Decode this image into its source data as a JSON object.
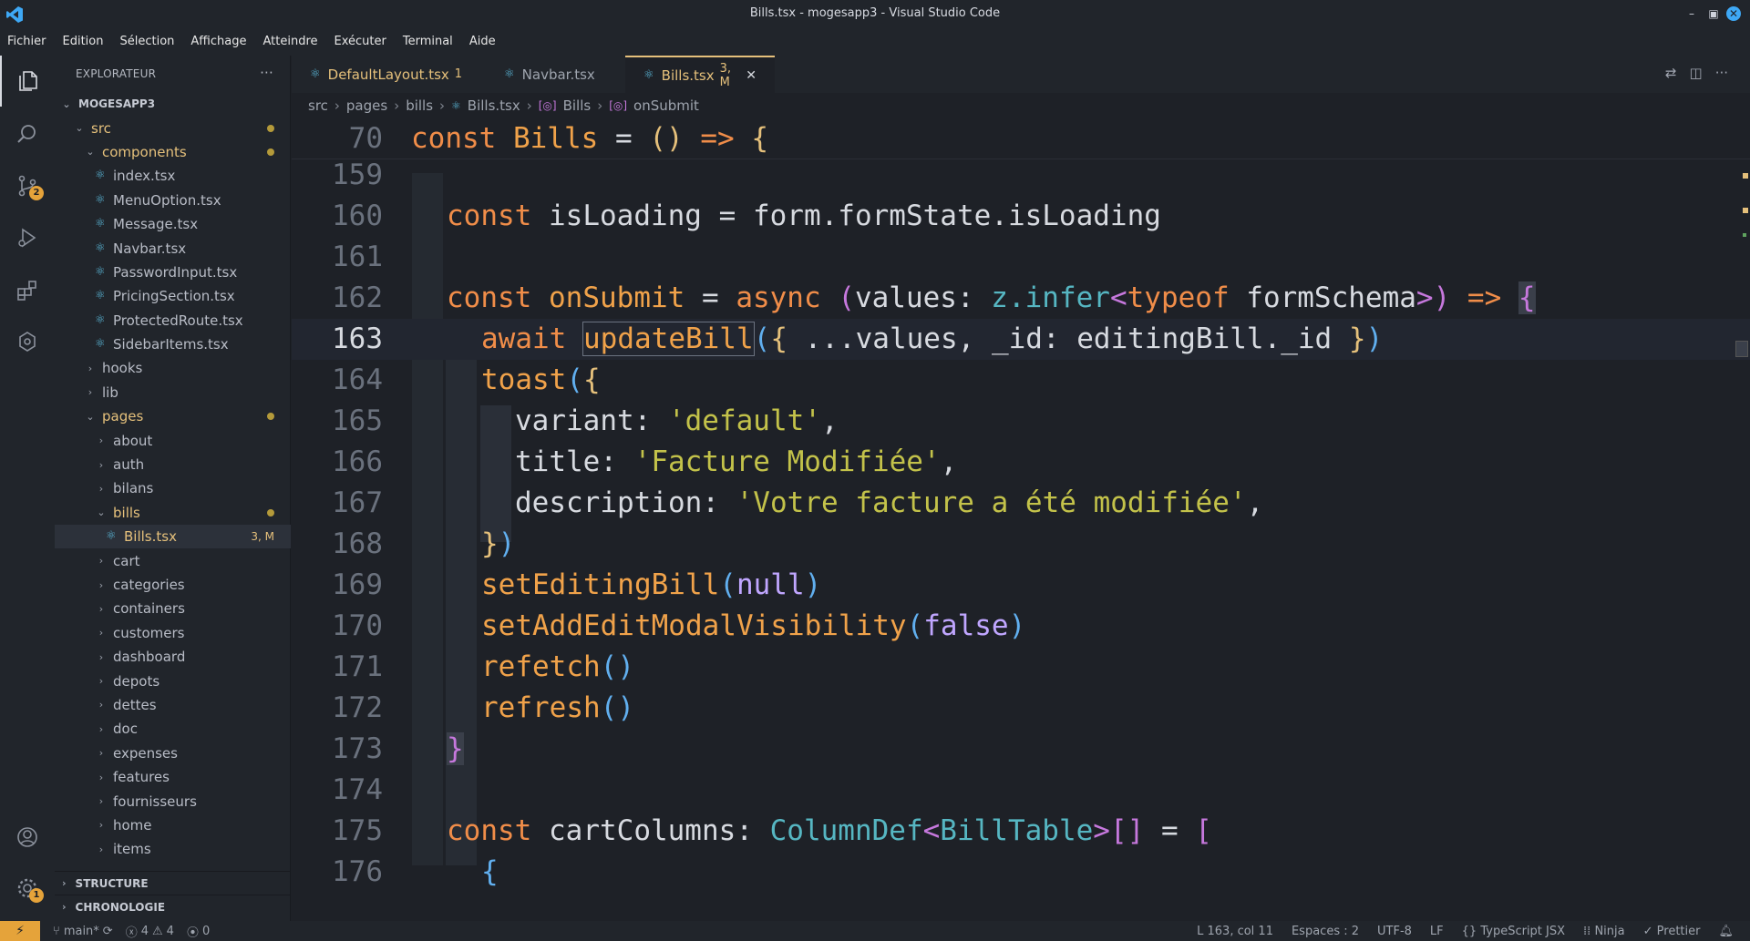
{
  "window": {
    "title": "Bills.tsx - mogesapp3 - Visual Studio Code"
  },
  "menu": [
    "Fichier",
    "Edition",
    "Sélection",
    "Affichage",
    "Atteindre",
    "Exécuter",
    "Terminal",
    "Aide"
  ],
  "activity": {
    "scm_badge": "2",
    "settings_badge": "1"
  },
  "explorer": {
    "header": "EXPLORATEUR",
    "root": "MOGESAPP3",
    "items": [
      {
        "label": "src",
        "kind": "folder-open",
        "depth": 1,
        "dot": true
      },
      {
        "label": "components",
        "kind": "folder-open",
        "depth": 2,
        "dot": true
      },
      {
        "label": "index.tsx",
        "kind": "file",
        "depth": 3
      },
      {
        "label": "MenuOption.tsx",
        "kind": "file",
        "depth": 3
      },
      {
        "label": "Message.tsx",
        "kind": "file",
        "depth": 3
      },
      {
        "label": "Navbar.tsx",
        "kind": "file",
        "depth": 3
      },
      {
        "label": "PasswordInput.tsx",
        "kind": "file",
        "depth": 3
      },
      {
        "label": "PricingSection.tsx",
        "kind": "file",
        "depth": 3
      },
      {
        "label": "ProtectedRoute.tsx",
        "kind": "file",
        "depth": 3
      },
      {
        "label": "SidebarItems.tsx",
        "kind": "file",
        "depth": 3
      },
      {
        "label": "hooks",
        "kind": "folder",
        "depth": 2
      },
      {
        "label": "lib",
        "kind": "folder",
        "depth": 2
      },
      {
        "label": "pages",
        "kind": "folder-open",
        "depth": 2,
        "dot": true
      },
      {
        "label": "about",
        "kind": "folder",
        "depth": 3
      },
      {
        "label": "auth",
        "kind": "folder",
        "depth": 3
      },
      {
        "label": "bilans",
        "kind": "folder",
        "depth": 3
      },
      {
        "label": "bills",
        "kind": "folder-open",
        "depth": 3,
        "dot": true
      },
      {
        "label": "Bills.tsx",
        "kind": "file-selected",
        "depth": 4,
        "meta": "3, M"
      },
      {
        "label": "cart",
        "kind": "folder",
        "depth": 3
      },
      {
        "label": "categories",
        "kind": "folder",
        "depth": 3
      },
      {
        "label": "containers",
        "kind": "folder",
        "depth": 3
      },
      {
        "label": "customers",
        "kind": "folder",
        "depth": 3
      },
      {
        "label": "dashboard",
        "kind": "folder",
        "depth": 3
      },
      {
        "label": "depots",
        "kind": "folder",
        "depth": 3
      },
      {
        "label": "dettes",
        "kind": "folder",
        "depth": 3
      },
      {
        "label": "doc",
        "kind": "folder",
        "depth": 3
      },
      {
        "label": "expenses",
        "kind": "folder",
        "depth": 3
      },
      {
        "label": "features",
        "kind": "folder",
        "depth": 3
      },
      {
        "label": "fournisseurs",
        "kind": "folder",
        "depth": 3
      },
      {
        "label": "home",
        "kind": "folder",
        "depth": 3
      },
      {
        "label": "items",
        "kind": "folder",
        "depth": 3
      }
    ],
    "sections": [
      "STRUCTURE",
      "CHRONOLOGIE"
    ]
  },
  "tabs": [
    {
      "label": "DefaultLayout.tsx",
      "meta": "1",
      "modified": true,
      "active": false
    },
    {
      "label": "Navbar.tsx",
      "meta": "",
      "modified": false,
      "active": false
    },
    {
      "label": "Bills.tsx",
      "meta": "3, M",
      "modified": true,
      "active": true
    }
  ],
  "breadcrumb": [
    "src",
    "pages",
    "bills",
    "Bills.tsx",
    "Bills",
    "onSubmit"
  ],
  "editor": {
    "sticky": {
      "ln": "70",
      "code": "const Bills = () => {"
    },
    "current_line": "163",
    "lines": [
      {
        "ln": "159"
      },
      {
        "ln": "160"
      },
      {
        "ln": "161"
      },
      {
        "ln": "162"
      },
      {
        "ln": "163"
      },
      {
        "ln": "164"
      },
      {
        "ln": "165"
      },
      {
        "ln": "166"
      },
      {
        "ln": "167"
      },
      {
        "ln": "168"
      },
      {
        "ln": "169"
      },
      {
        "ln": "170"
      },
      {
        "ln": "171"
      },
      {
        "ln": "172"
      },
      {
        "ln": "173"
      },
      {
        "ln": "174"
      },
      {
        "ln": "175"
      },
      {
        "ln": "176"
      }
    ],
    "tokens": {
      "l160_a": "const",
      "l160_b": "isLoading",
      "l160_c": " = ",
      "l160_d": "form.formState.isLoading",
      "l162_const": "const",
      "l162_name": "onSubmit",
      "l162_eq": " = ",
      "l162_async": "async",
      "l162_paren": "(",
      "l162_values": "values",
      "l162_colon": ": ",
      "l162_z": "z.infer",
      "l162_lt": "<",
      "l162_typeof": "typeof",
      "l162_schema": "formSchema",
      "l162_gt": ">",
      "l162_close": ")",
      "l162_arrow": " => ",
      "l162_brace": "{",
      "l163_await": "await",
      "l163_fn": "updateBill",
      "l163_p": "(",
      "l163_b": "{",
      "l163_rest": " ...values, _id: editingBill._id ",
      "l163_b2": "}",
      "l163_p2": ")",
      "l164_fn": "toast",
      "l164_p": "(",
      "l164_b": "{",
      "l165_k": "variant",
      "l165_c": ": ",
      "l165_v": "'default'",
      "l165_e": ",",
      "l166_k": "title",
      "l166_c": ": ",
      "l166_v": "'Facture Modifiée'",
      "l166_e": ",",
      "l167_k": "description",
      "l167_c": ": ",
      "l167_v": "'Votre facture a été modifiée'",
      "l167_e": ",",
      "l168_b": "}",
      "l168_p": ")",
      "l169_fn": "setEditingBill",
      "l169_p": "(",
      "l169_v": "null",
      "l169_p2": ")",
      "l170_fn": "setAddEditModalVisibility",
      "l170_p": "(",
      "l170_v": "false",
      "l170_p2": ")",
      "l171_fn": "refetch",
      "l171_p": "()",
      "l172_fn": "refresh",
      "l172_p": "()",
      "l173_b": "}",
      "l175_const": "const",
      "l175_name": "cartColumns",
      "l175_colon": ": ",
      "l175_type": "ColumnDef",
      "l175_lt": "<",
      "l175_t2": "BillTable",
      "l175_gt": ">",
      "l175_arr": "[]",
      "l175_eq": " = ",
      "l175_br": "[",
      "l176_b": "{"
    }
  },
  "status": {
    "branch": "main*",
    "errors": "4",
    "warnings": "4",
    "ports": "0",
    "position": "L 163, col 11",
    "spaces": "Espaces : 2",
    "encoding": "UTF-8",
    "eol": "LF",
    "language": "TypeScript JSX",
    "ninja": "Ninja",
    "prettier": "Prettier"
  }
}
